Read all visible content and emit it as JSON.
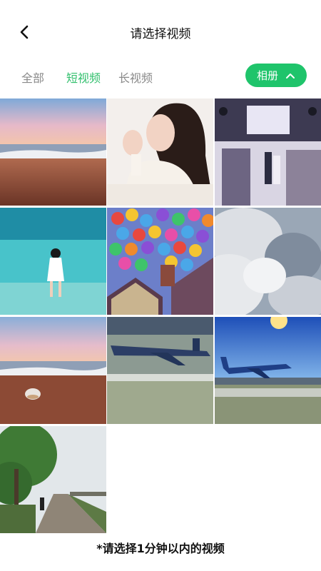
{
  "header": {
    "title": "请选择视频",
    "back_icon": "chevron-left-icon"
  },
  "tabs": [
    {
      "label": "全部",
      "active": false
    },
    {
      "label": "短视频",
      "active": true
    },
    {
      "label": "长视频",
      "active": false
    }
  ],
  "album_button": {
    "label": "相册",
    "icon": "chevron-up-icon",
    "color": "#1fc46b"
  },
  "accent_color": "#33c06e",
  "videos": [
    {
      "subject": "sunset beach"
    },
    {
      "subject": "woman in sweater"
    },
    {
      "subject": "wedding stage"
    },
    {
      "subject": "girl in turquoise sea"
    },
    {
      "subject": "balloons over house"
    },
    {
      "subject": "clouds"
    },
    {
      "subject": "beach with shell"
    },
    {
      "subject": "airplane taxiing"
    },
    {
      "subject": "airplane on runway"
    },
    {
      "subject": "tree-lined path"
    }
  ],
  "footer": {
    "note": "*请选择1分钟以内的视频"
  }
}
